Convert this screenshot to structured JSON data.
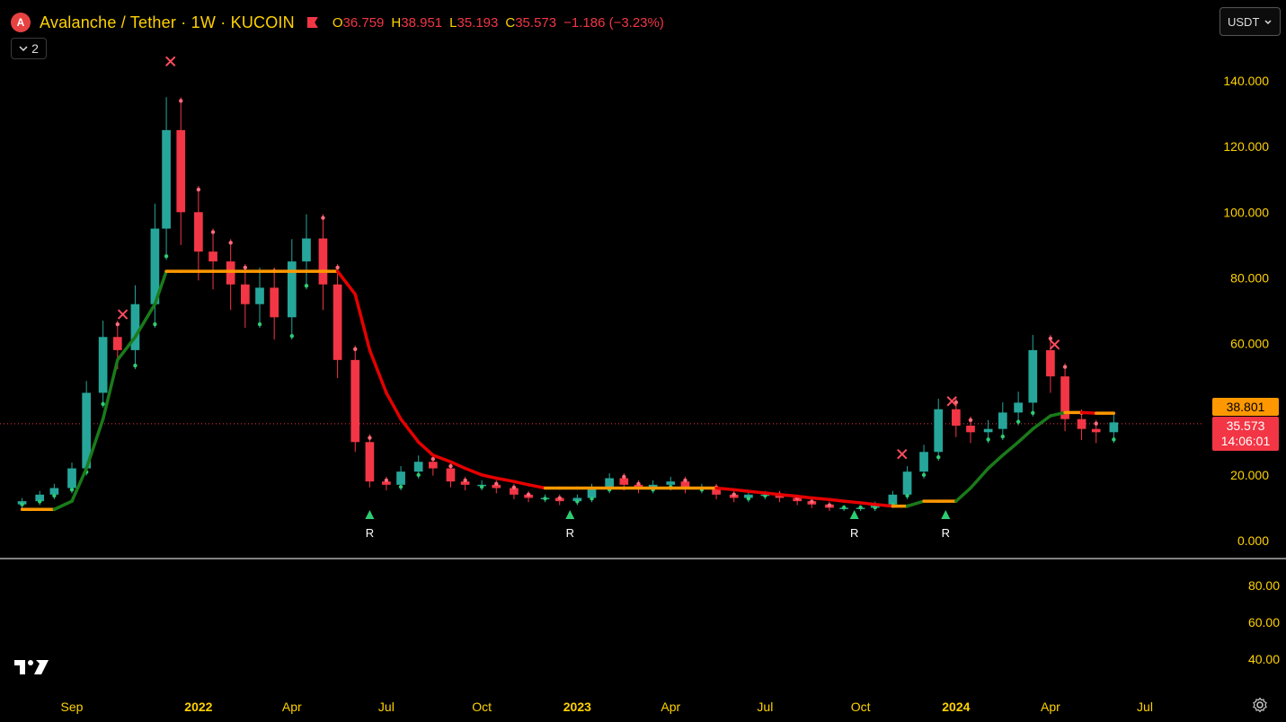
{
  "header": {
    "logo_letter": "A",
    "symbol": "Avalanche / Tether · 1W · KUCOIN",
    "ohlc": {
      "open_label": "O",
      "open": "36.759",
      "high_label": "H",
      "high": "38.951",
      "low_label": "L",
      "low": "35.193",
      "close_label": "C",
      "close": "35.573",
      "change": "−1.186 (−3.23%)"
    }
  },
  "indicator_toggle": {
    "count": "2",
    "icon": "chevron-down-icon"
  },
  "currency_select": {
    "value": "USDT",
    "icon": "chevron-down-icon"
  },
  "price_tags": {
    "level": "38.801",
    "last_price": "35.573",
    "countdown": "14:06:01"
  },
  "colors": {
    "up": "#26a69a",
    "down": "#f23645",
    "support_up": "#1a7a1a",
    "support_down": "#e60000",
    "flat": "#ff9800",
    "axis_text": "#ffd200",
    "background": "#000000"
  },
  "chart_data": {
    "type": "candlestick",
    "y_axis": {
      "min": 0,
      "max": 140,
      "ticks": [
        0,
        20,
        40,
        60,
        80,
        100,
        120,
        140
      ],
      "tick_labels": [
        "0.000",
        "20.000",
        "40.000",
        "60.000",
        "80.000",
        "100.000",
        "120.000",
        "140.000"
      ],
      "position": "right"
    },
    "x_axis": {
      "tick_labels": [
        "Sep",
        "2022",
        "Apr",
        "Jul",
        "Oct",
        "2023",
        "Apr",
        "Jul",
        "Oct",
        "2024",
        "Apr",
        "Jul"
      ],
      "tick_dates": [
        "2021-09-01",
        "2022-01-01",
        "2022-04-01",
        "2022-07-01",
        "2022-10-01",
        "2023-01-01",
        "2023-04-01",
        "2023-07-01",
        "2023-10-01",
        "2024-01-01",
        "2024-04-01",
        "2024-07-01"
      ]
    },
    "last_price": 35.573,
    "level": 38.801,
    "close_series": {
      "dates": [
        "2021-07-15",
        "2021-08-01",
        "2021-08-15",
        "2021-09-01",
        "2021-09-15",
        "2021-10-01",
        "2021-10-15",
        "2021-11-01",
        "2021-11-20",
        "2021-12-01",
        "2021-12-15",
        "2022-01-01",
        "2022-01-15",
        "2022-02-01",
        "2022-02-15",
        "2022-03-01",
        "2022-03-15",
        "2022-04-01",
        "2022-04-15",
        "2022-05-01",
        "2022-05-15",
        "2022-06-01",
        "2022-06-15",
        "2022-07-01",
        "2022-07-15",
        "2022-08-01",
        "2022-08-15",
        "2022-09-01",
        "2022-09-15",
        "2022-10-01",
        "2022-10-15",
        "2022-11-01",
        "2022-11-15",
        "2022-12-01",
        "2022-12-15",
        "2023-01-01",
        "2023-01-15",
        "2023-02-01",
        "2023-02-15",
        "2023-03-01",
        "2023-03-15",
        "2023-04-01",
        "2023-04-15",
        "2023-05-01",
        "2023-05-15",
        "2023-06-01",
        "2023-06-15",
        "2023-07-01",
        "2023-07-15",
        "2023-08-01",
        "2023-08-15",
        "2023-09-01",
        "2023-09-15",
        "2023-10-01",
        "2023-10-15",
        "2023-11-01",
        "2023-11-15",
        "2023-12-01",
        "2023-12-15",
        "2024-01-01",
        "2024-01-15",
        "2024-02-01",
        "2024-02-15",
        "2024-03-01",
        "2024-03-15",
        "2024-04-01",
        "2024-04-15",
        "2024-05-01",
        "2024-05-15",
        "2024-06-01"
      ],
      "values": [
        12,
        14,
        16,
        22,
        45,
        62,
        58,
        72,
        95,
        125,
        100,
        88,
        85,
        78,
        72,
        77,
        68,
        85,
        92,
        78,
        55,
        30,
        18,
        17,
        21,
        24,
        22,
        18,
        17,
        17,
        16,
        14,
        13,
        13,
        12,
        13,
        16,
        19,
        17,
        16,
        17,
        18,
        16,
        16,
        14,
        13,
        14,
        14,
        13,
        12,
        11,
        10,
        10,
        10,
        11,
        14,
        21,
        27,
        40,
        35,
        33,
        34,
        39,
        42,
        58,
        50,
        37,
        34,
        33,
        36
      ]
    },
    "support_line": {
      "values": [
        9.5,
        9.5,
        9.5,
        12,
        22,
        37,
        55,
        62,
        72,
        82,
        82,
        82,
        82,
        82,
        82,
        82,
        82,
        82,
        82,
        82,
        82,
        75,
        58,
        45,
        37,
        30,
        26,
        24,
        22,
        20,
        19,
        18,
        17,
        16,
        16,
        16,
        16,
        16,
        16,
        16,
        16,
        16,
        16,
        16,
        16,
        15.5,
        15,
        14.5,
        14,
        13.5,
        13,
        12.5,
        12,
        11.5,
        11,
        10.5,
        10.5,
        12,
        12,
        12,
        16,
        22,
        26,
        30,
        34,
        38,
        39,
        39,
        38.8,
        38.8
      ]
    },
    "markers": {
      "R": [
        "2022-06-15",
        "2022-12-25",
        "2023-09-25",
        "2023-12-22"
      ],
      "x": [
        "2021-10-20",
        "2021-12-05",
        "2023-11-10",
        "2023-12-28",
        "2024-04-05"
      ]
    }
  }
}
